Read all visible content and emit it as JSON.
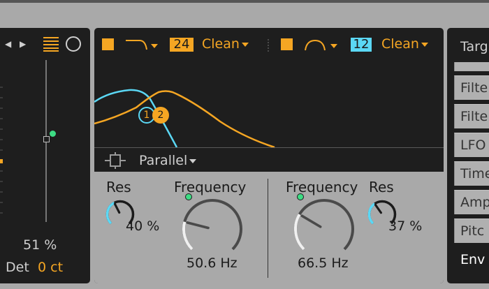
{
  "left_panel": {
    "percent": "51 %",
    "det_label": "Det",
    "det_value": "0 ct"
  },
  "filter1": {
    "slope": "24",
    "mode": "Clean"
  },
  "filter2": {
    "slope": "12",
    "mode": "Clean"
  },
  "graph": {
    "marker1": "1",
    "marker2": "2"
  },
  "routing": {
    "mode": "Parallel"
  },
  "controls": {
    "res1_label": "Res",
    "res1_value": "40 %",
    "freq1_label": "Frequency",
    "freq1_value": "50.6 Hz",
    "freq2_label": "Frequency",
    "freq2_value": "66.5 Hz",
    "res2_label": "Res",
    "res2_value": "37 %"
  },
  "right_panel": {
    "header": "Targ",
    "items": [
      "Filte",
      "Filte",
      "LFO",
      "Time",
      "Amp",
      "Pitc",
      "Env"
    ]
  },
  "colors": {
    "accent_orange": "#f5a623",
    "accent_cyan": "#5bd8f5",
    "indicator_green": "#3ddc84"
  },
  "levels": {
    "res1": 0.4,
    "res2": 0.37,
    "freq1_knob": 0.22,
    "freq2_knob": 0.28,
    "left_slider": 0.51
  }
}
